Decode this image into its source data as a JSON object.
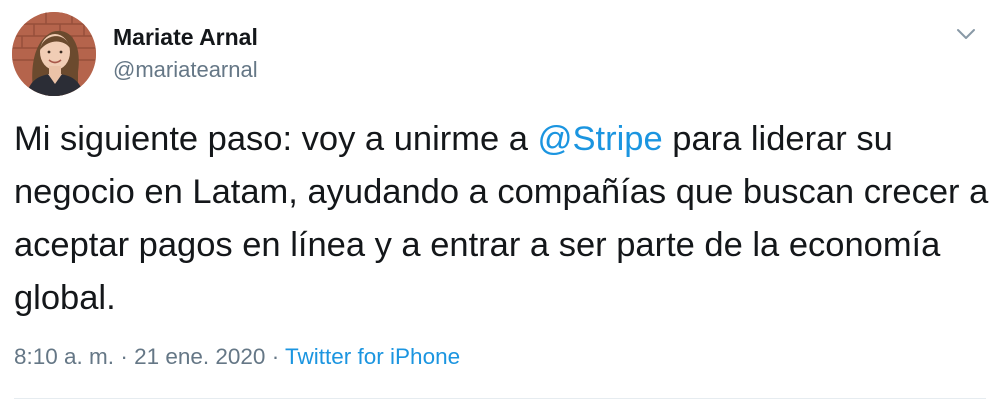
{
  "author": {
    "name": "Mariate Arnal",
    "handle": "@mariatearnal"
  },
  "tweet": {
    "text_before": "Mi siguiente paso: voy a unirme a ",
    "mention": "@Stripe",
    "text_after": " para liderar su negocio en Latam, ayudando a compañías que buscan crecer a aceptar pagos en línea y a entrar a ser parte de la economía global."
  },
  "meta": {
    "time": "8:10 a. m.",
    "separator1": " · ",
    "date": "21 ene. 2020",
    "separator2": " · ",
    "source": "Twitter for iPhone"
  },
  "icons": {
    "menu": "chevron-down-icon"
  },
  "colors": {
    "link": "#1b95e0",
    "secondary_text": "#657786",
    "primary_text": "#14171a"
  }
}
